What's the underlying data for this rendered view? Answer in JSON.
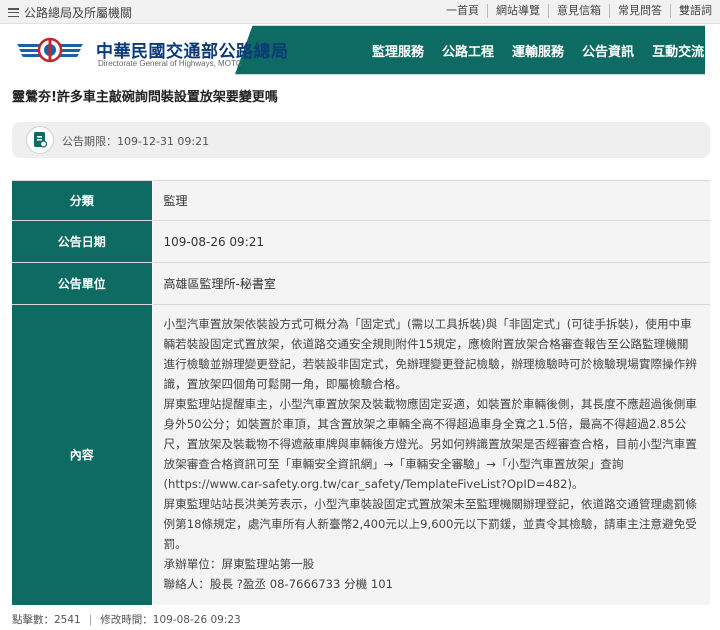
{
  "topbar": {
    "site_link": "公路總局及所屬機關",
    "links": [
      "一首頁",
      "網站導覽",
      "意見信箱",
      "常見問答",
      "雙語詞"
    ]
  },
  "header": {
    "logo_title": "中華民國交通部公路總局",
    "logo_subtitle": "Directorate General of Highways, MOTC",
    "nav": [
      "監理服務",
      "公路工程",
      "運輸服務",
      "公告資訊",
      "互動交流",
      "…"
    ]
  },
  "article": {
    "title": "靈鶯夯!許多車主敲碗詢問裝設置放架要變更嗎",
    "announce_period": "公告期限：109-12-31 09:21",
    "rows": [
      {
        "label": "分類",
        "value": "監理"
      },
      {
        "label": "公告日期",
        "value": "109-08-26 09:21"
      },
      {
        "label": "公告單位",
        "value": "高雄區監理所-秘書室"
      }
    ],
    "content_label": "內容",
    "content": [
      "小型汽車置放架依裝設方式可概分為「固定式」(需以工具拆裝)與「非固定式」(可徒手拆裝)，使用中車輛若裝設固定式置放架，依道路交通安全規則附件15規定，應檢附置放架合格審查報告至公路監理機關進行檢驗並辦理變更登記，若裝設非固定式，免辦理變更登記檢驗，辦理檢驗時可於檢驗現場實際操作辨識，置放架四個角可鬆開一角，即屬檢驗合格。",
      "屏東監理站提醒車主，小型汽車置放架及裝載物應固定妥適，如裝置於車輛後側，其長度不應超過後側車身外50公分；如裝置於車頂，其含置放架之車輛全高不得超過車身全寬之1.5倍，最高不得超過2.85公尺，置放架及裝載物不得遮蔽車牌與車輛後方燈光。另如何辨識置放架是否經審查合格，目前小型汽車置放架審查合格資訊可至「車輛安全資訊網」→「車輛安全審驗」→「小型汽車置放架」查詢(https://www.car-safety.org.tw/car_safety/TemplateFiveList?OpID=482)。",
      "屏東監理站站長洪美芳表示，小型汽車裝設固定式置放架未至監理機關辦理登記，依道路交通管理處罰條例第18條規定，處汽車所有人新臺幣2,400元以上9,600元以下罰鍰，並責令其檢驗，請車主注意避免受罰。",
      "承辦單位：屏東監理站第一股",
      "聯絡人：股長 ?盈丞 08-7666733 分機 101"
    ]
  },
  "footer": {
    "clicks": "點擊數：2541",
    "modified": "修改時間：109-08-26 09:23"
  },
  "colors": {
    "primary_green": "#0e6b63",
    "logo_blue": "#0b3a7a"
  }
}
